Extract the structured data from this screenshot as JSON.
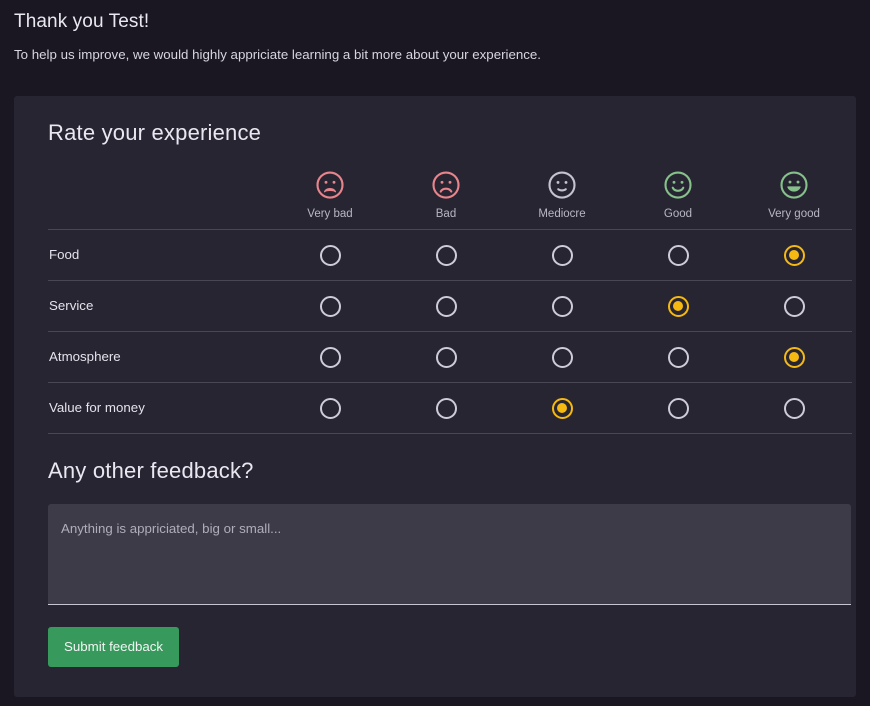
{
  "intro": {
    "title": "Thank you Test!",
    "subtitle": "To help us improve, we would highly appriciate learning a bit more about your experience."
  },
  "rating_section": {
    "title": "Rate your experience",
    "scale": [
      {
        "label": "Very bad",
        "icon": "face-very-sad-icon",
        "color": "#e8858c"
      },
      {
        "label": "Bad",
        "icon": "face-sad-icon",
        "color": "#e8858c"
      },
      {
        "label": "Mediocre",
        "icon": "face-neutral-icon",
        "color": "#c6c3d0"
      },
      {
        "label": "Good",
        "icon": "face-smile-icon",
        "color": "#86c08a"
      },
      {
        "label": "Very good",
        "icon": "face-grin-icon",
        "color": "#86c08a"
      }
    ],
    "rows": [
      {
        "label": "Food",
        "selected": 4
      },
      {
        "label": "Service",
        "selected": 3
      },
      {
        "label": "Atmosphere",
        "selected": 4
      },
      {
        "label": "Value for money",
        "selected": 2
      }
    ]
  },
  "feedback_section": {
    "title": "Any other feedback?",
    "textarea_value": "",
    "textarea_placeholder": "Anything is appriciated, big or small..."
  },
  "submit": {
    "label": "Submit feedback",
    "color": "#379a5c"
  }
}
